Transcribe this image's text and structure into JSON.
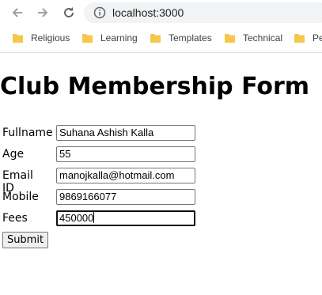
{
  "browser": {
    "url": "localhost:3000",
    "bookmarks": [
      {
        "label": "Religious"
      },
      {
        "label": "Learning"
      },
      {
        "label": "Templates"
      },
      {
        "label": "Technical"
      },
      {
        "label": "Pe"
      }
    ]
  },
  "page": {
    "title": "Club Membership Form"
  },
  "form": {
    "fields": [
      {
        "label": "Fullname",
        "value": "Suhana Ashish Kalla"
      },
      {
        "label": "Age",
        "value": "55"
      },
      {
        "label": "Email ID",
        "value": "manojkalla@hotmail.com"
      },
      {
        "label": "Mobile",
        "value": "9869166077"
      },
      {
        "label": "Fees",
        "value": "450000"
      }
    ],
    "submit_label": "Submit"
  },
  "colors": {
    "folder": "#f5c84b",
    "icon": "#5f6368",
    "omnibox_bg": "#f1f3f4"
  }
}
